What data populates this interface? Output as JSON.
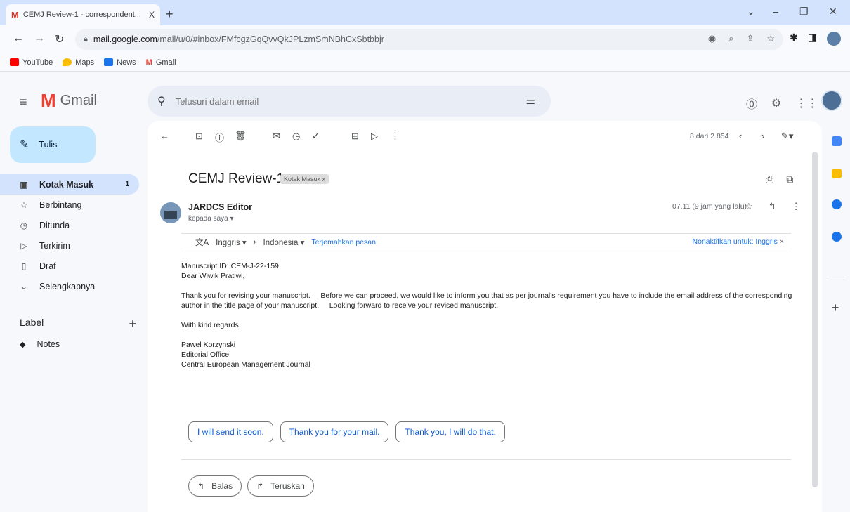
{
  "browser": {
    "tab_title": "CEMJ Review-1 - correspondent...",
    "tab_close": "X",
    "url_host": "mail.google.com",
    "url_path": "/mail/u/0/#inbox/FMfcgzGqQvvQkJPLzmSmNBhCxSbtbbjr",
    "bookmarks": [
      "YouTube",
      "Maps",
      "News",
      "Gmail"
    ],
    "bookmark_colors": [
      "#ff0000",
      "#fbbc04",
      "#1a73e8",
      "#ea4335"
    ]
  },
  "gmail": {
    "logo_text": "Gmail",
    "search_placeholder": "Telusuri dalam email",
    "compose_label": "Tulis",
    "nav": [
      {
        "label": "Kotak Masuk",
        "count": "1",
        "icon": "inbox-icon"
      },
      {
        "label": "Berbintang",
        "icon": "star-icon"
      },
      {
        "label": "Ditunda",
        "icon": "clock-icon"
      },
      {
        "label": "Terkirim",
        "icon": "send-icon"
      },
      {
        "label": "Draf",
        "icon": "draft-icon"
      },
      {
        "label": "Selengkapnya",
        "icon": "chevron-down-icon"
      }
    ],
    "labels_header": "Label",
    "labels": [
      {
        "label": "Notes",
        "icon": "label-icon"
      }
    ]
  },
  "message": {
    "pager": "8 dari 2.854",
    "subject": "CEMJ Review-1",
    "label_chip": "Kotak Masuk x",
    "sender": "JARDCS Editor",
    "to": "kepada saya ▾",
    "time": "07.11 (9 jam yang lalu)",
    "translate": {
      "from": "Inggris ▾",
      "to": "Indonesia ▾",
      "translate_link": "Terjemahkan pesan",
      "disable_link": "Nonaktifkan untuk: Inggris"
    },
    "body": {
      "line1": "Manuscript ID: CEM-J-22-159",
      "line2": "Dear Wiwik Pratiwi,",
      "para1": "Thank you for revising your manuscript.     Before we can proceed, we would like to inform you that as per journal's requirement you have to include the email address of the corresponding author in the title page of your manuscript.     Looking forward to receive your revised manuscript.",
      "closing": "With kind regards,",
      "sig_name": "Pawel Korzynski",
      "sig_office": "Editorial Office",
      "sig_org": "Central European Management Journal"
    },
    "smart_replies": [
      "I will send it soon.",
      "Thank you for your mail.",
      "Thank you, I will do that."
    ],
    "reply_label": "Balas",
    "forward_label": "Teruskan"
  },
  "colors": {
    "compose_bg": "#c2e7ff",
    "active_nav": "#d3e3fd",
    "link": "#1a73e8",
    "side_panel": [
      "#fbbc04",
      "#4285f4",
      "#1a73e8"
    ]
  }
}
